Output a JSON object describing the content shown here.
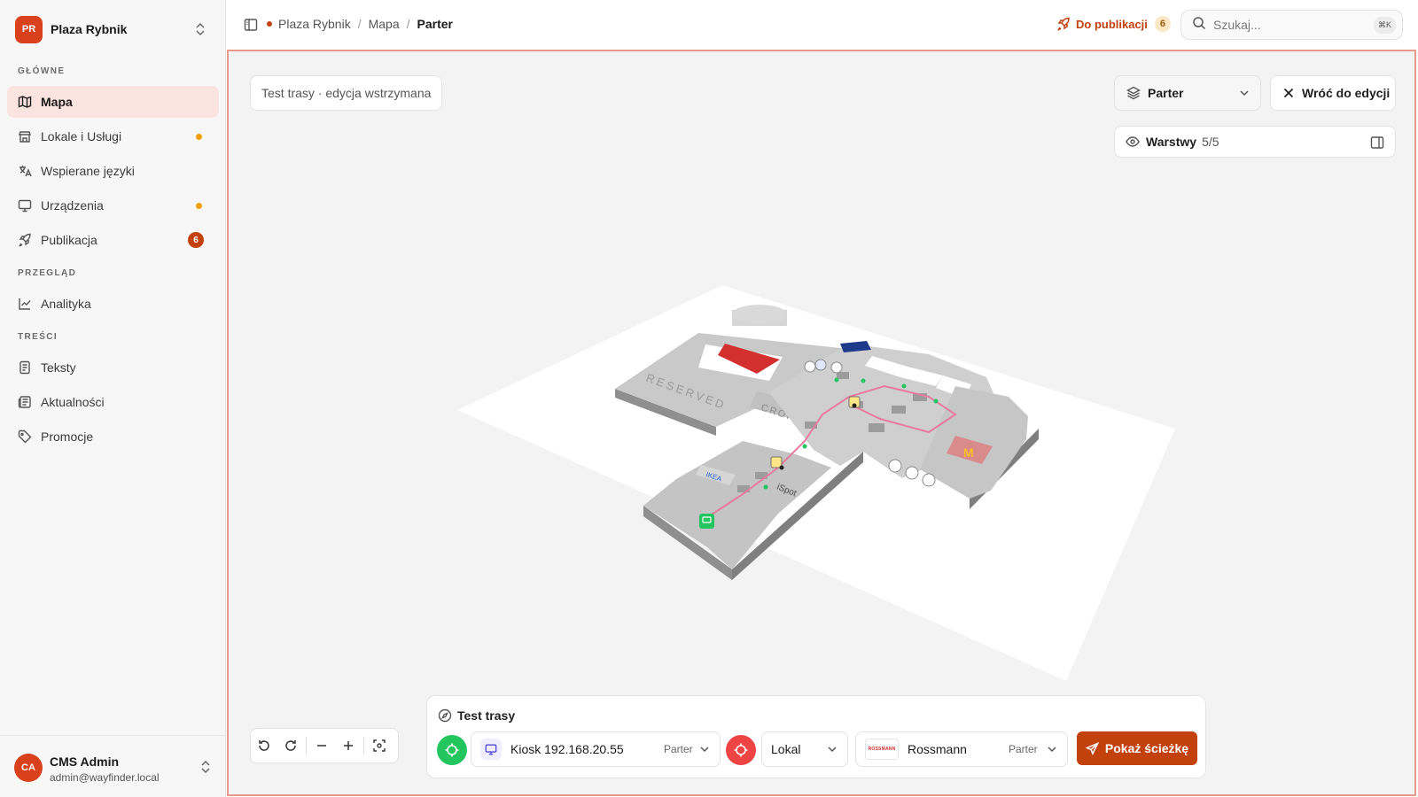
{
  "org": {
    "initials": "PR",
    "name": "Plaza Rybnik"
  },
  "sidebar": {
    "sections": [
      {
        "label": "GŁÓWNE"
      },
      {
        "label": "PRZEGLĄD"
      },
      {
        "label": "TREŚCI"
      }
    ],
    "items": [
      {
        "label": "Mapa",
        "icon": "map-icon",
        "active": true
      },
      {
        "label": "Lokale i Usługi",
        "icon": "store-icon",
        "indicator": "dot"
      },
      {
        "label": "Wspierane języki",
        "icon": "languages-icon"
      },
      {
        "label": "Urządzenia",
        "icon": "monitor-icon",
        "indicator": "dot"
      },
      {
        "label": "Publikacja",
        "icon": "rocket-icon",
        "badge": "6"
      },
      {
        "label": "Analityka",
        "icon": "chart-line-icon"
      },
      {
        "label": "Teksty",
        "icon": "file-text-icon"
      },
      {
        "label": "Aktualności",
        "icon": "newspaper-icon"
      },
      {
        "label": "Promocje",
        "icon": "tag-icon"
      }
    ]
  },
  "user": {
    "initials": "CA",
    "name": "CMS Admin",
    "email": "admin@wayfinder.local"
  },
  "header": {
    "breadcrumb": [
      "Plaza Rybnik",
      "Mapa",
      "Parter"
    ],
    "publish_label": "Do publikacji",
    "publish_count": "6",
    "search_placeholder": "Szukaj...",
    "search_shortcut": "⌘K"
  },
  "map": {
    "status": "Test trasy · edycja wstrzymana",
    "floor": "Parter",
    "back_label": "Wróć do edycji",
    "layers_label": "Warstwy",
    "layers_count": "5/5",
    "labels": {
      "reserved": "RESERVED",
      "cropp": "CROPP",
      "ispot": "iSpot",
      "ikea": "IKEA",
      "mcdonalds": "M"
    }
  },
  "route": {
    "title": "Test trasy",
    "start": {
      "value": "Kiosk 192.168.20.55",
      "floor": "Parter"
    },
    "type": "Lokal",
    "destination": {
      "logo_text": "ROSSMANN",
      "value": "Rossmann",
      "floor": "Parter"
    },
    "show_label": "Pokaż ścieżkę"
  },
  "colors": {
    "accent": "#c2410c",
    "active_bg": "#fbe3df",
    "dot": "#f59e0b",
    "start": "#22c55e",
    "end": "#ef4444",
    "route_line": "#e87aa0"
  }
}
